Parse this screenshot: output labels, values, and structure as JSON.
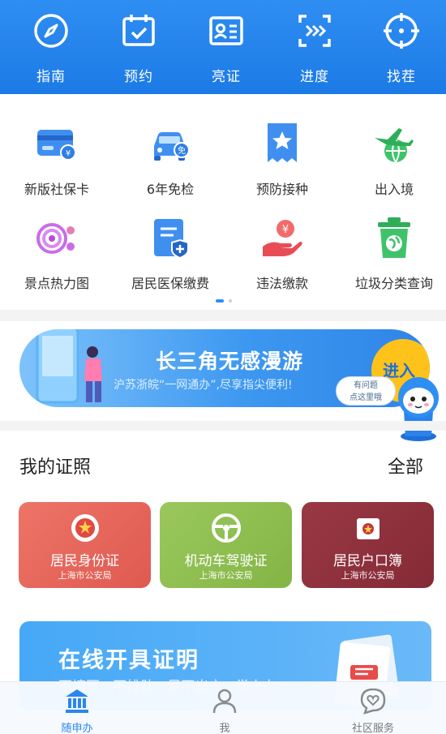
{
  "top_nav": [
    {
      "label": "指南",
      "icon": "compass-icon"
    },
    {
      "label": "预约",
      "icon": "calendar-check-icon"
    },
    {
      "label": "亮证",
      "icon": "id-card-icon"
    },
    {
      "label": "进度",
      "icon": "progress-icon"
    },
    {
      "label": "找茬",
      "icon": "target-icon"
    }
  ],
  "services": [
    {
      "label": "新版社保卡",
      "icon": "social-security-card-icon"
    },
    {
      "label": "6年免检",
      "icon": "car-exemption-icon"
    },
    {
      "label": "预防接种",
      "icon": "vaccination-star-icon"
    },
    {
      "label": "出入境",
      "icon": "airplane-globe-icon"
    },
    {
      "label": "景点热力图",
      "icon": "heatmap-icon"
    },
    {
      "label": "居民医保缴费",
      "icon": "medical-insurance-icon"
    },
    {
      "label": "违法缴款",
      "icon": "fine-payment-icon"
    },
    {
      "label": "垃圾分类查询",
      "icon": "trash-globe-icon"
    }
  ],
  "banner": {
    "title": "长三角无感漫游",
    "subtitle": "沪苏浙皖“一网通办”,尽享指尖便利!",
    "button": "进入",
    "help_line1": "有问题",
    "help_line2": "点这里哦"
  },
  "licenses": {
    "title": "我的证照",
    "more": "全部",
    "cards": [
      {
        "title": "居民身份证",
        "issuer": "上海市公安局",
        "color": "#e8675c"
      },
      {
        "title": "机动车驾驶证",
        "issuer": "上海市公安局",
        "color": "#8fbd4e"
      },
      {
        "title": "居民户口簿",
        "issuer": "上海市公安局",
        "color": "#8e2f3c"
      }
    ]
  },
  "promo": {
    "title": "在线开具证明",
    "subtitle": "不填写 · 不排队 · 足不出户 · 掌上办"
  },
  "tabbar": [
    {
      "label": "随申办",
      "icon": "bank-building-icon",
      "active": true
    },
    {
      "label": "我",
      "icon": "person-icon",
      "active": false
    },
    {
      "label": "社区服务",
      "icon": "heart-chat-icon",
      "active": false
    }
  ],
  "colors": {
    "primary": "#1c7ae6",
    "accent": "#ffc21a",
    "tab_active": "#2b86ee"
  }
}
